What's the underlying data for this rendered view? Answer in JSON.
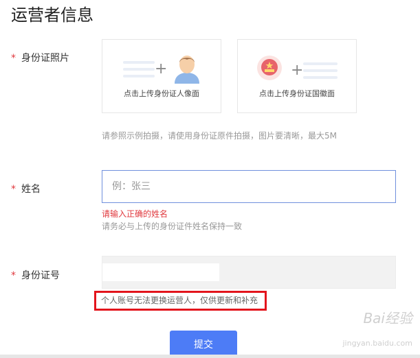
{
  "page": {
    "title": "运营者信息"
  },
  "id_photo": {
    "required_mark": "*",
    "label": "身份证照片",
    "front_caption": "点击上传身份证人像面",
    "back_caption": "点击上传身份证国徽面",
    "hint": "请参照示例拍摄，请使用身份证原件拍摄，图片要清晰，最大5M"
  },
  "name": {
    "required_mark": "*",
    "label": "姓名",
    "value": "",
    "placeholder": "例：张三",
    "error": "请输入正确的姓名",
    "hint": "请务必与上传的身份证件姓名保持一致"
  },
  "id_number": {
    "required_mark": "*",
    "label": "身份证号",
    "notice": "个人账号无法更换运营人，仅供更新和补充"
  },
  "actions": {
    "submit_label": "提交"
  },
  "watermark": {
    "brand": "Bai经验",
    "site": "jingyan.baidu.com"
  },
  "colors": {
    "accent": "#4d7cf6",
    "error": "#e0393e",
    "highlight_border": "#e3141c"
  }
}
